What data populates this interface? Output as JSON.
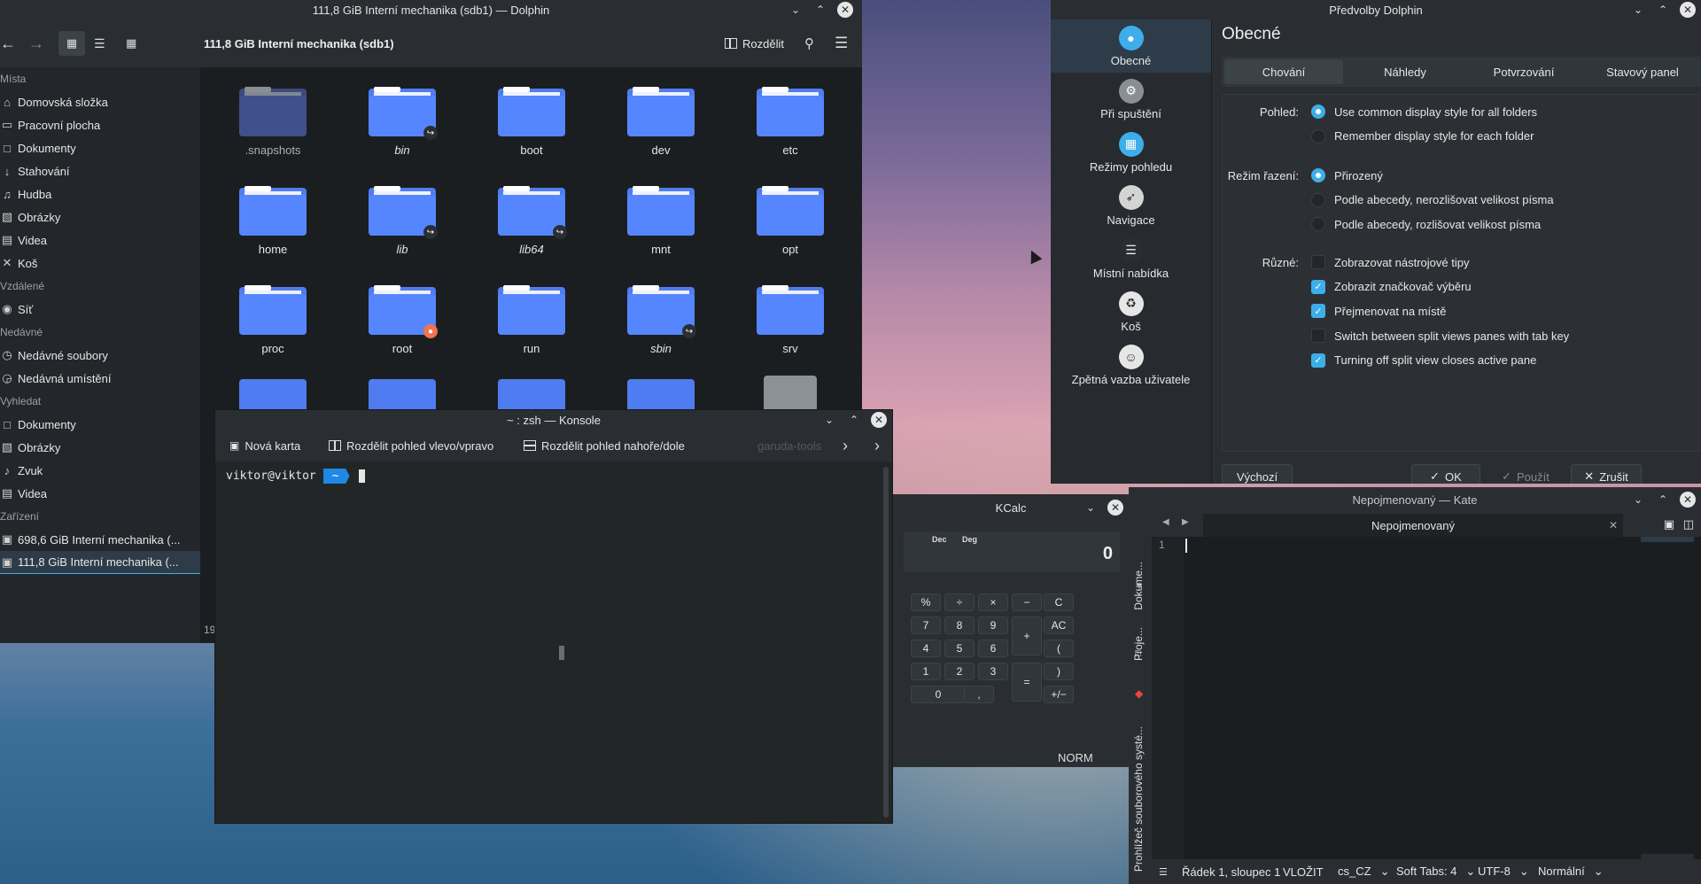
{
  "dolphin": {
    "window_title": "111,8 GiB Interní mechanika (sdb1) — Dolphin",
    "location": "111,8 GiB Interní mechanika (sdb1)",
    "split_label": "Rozdělit",
    "status_partial": "19",
    "sidebar": [
      {
        "type": "section",
        "label": "Místa"
      },
      {
        "type": "item",
        "label": "Domovská složka",
        "icon": "home-icon"
      },
      {
        "type": "item",
        "label": "Pracovní plocha",
        "icon": "desktop-icon"
      },
      {
        "type": "item",
        "label": "Dokumenty",
        "icon": "documents-icon"
      },
      {
        "type": "item",
        "label": "Stahování",
        "icon": "download-icon"
      },
      {
        "type": "item",
        "label": "Hudba",
        "icon": "music-icon"
      },
      {
        "type": "item",
        "label": "Obrázky",
        "icon": "pictures-icon"
      },
      {
        "type": "item",
        "label": "Videa",
        "icon": "videos-icon"
      },
      {
        "type": "item",
        "label": "Koš",
        "icon": "trash-icon"
      },
      {
        "type": "section",
        "label": "Vzdálené"
      },
      {
        "type": "item",
        "label": "Síť",
        "icon": "network-icon"
      },
      {
        "type": "section",
        "label": "Nedávné"
      },
      {
        "type": "item",
        "label": "Nedávné soubory",
        "icon": "recent-files-icon"
      },
      {
        "type": "item",
        "label": "Nedávná umístění",
        "icon": "recent-places-icon"
      },
      {
        "type": "section",
        "label": "Vyhledat"
      },
      {
        "type": "item",
        "label": "Dokumenty",
        "icon": "documents-icon"
      },
      {
        "type": "item",
        "label": "Obrázky",
        "icon": "pictures-icon"
      },
      {
        "type": "item",
        "label": "Zvuk",
        "icon": "audio-icon"
      },
      {
        "type": "item",
        "label": "Videa",
        "icon": "videos-icon"
      },
      {
        "type": "section",
        "label": "Zařízení"
      },
      {
        "type": "item",
        "label": "698,6 GiB Interní mechanika (...",
        "icon": "drive-icon"
      },
      {
        "type": "item",
        "label": "111,8 GiB Interní mechanika (...",
        "icon": "drive-icon",
        "active": true
      }
    ],
    "folders": [
      {
        "name": ".snapshots",
        "hidden": true
      },
      {
        "name": "bin",
        "link": true
      },
      {
        "name": "boot"
      },
      {
        "name": "dev"
      },
      {
        "name": "etc"
      },
      {
        "name": "home"
      },
      {
        "name": "lib",
        "link": true
      },
      {
        "name": "lib64",
        "link": true
      },
      {
        "name": "mnt"
      },
      {
        "name": "opt"
      },
      {
        "name": "proc"
      },
      {
        "name": "root",
        "locked": true
      },
      {
        "name": "run"
      },
      {
        "name": "sbin",
        "link": true
      },
      {
        "name": "srv"
      }
    ]
  },
  "prefs": {
    "window_title": "Předvolby Dolphin",
    "page_title": "Obecné",
    "nav": [
      {
        "label": "Obecné",
        "icon": "general-icon",
        "color": "#3daee9",
        "active": true
      },
      {
        "label": "Při spuštění",
        "icon": "startup-gear-icon",
        "color": "#8a8f94"
      },
      {
        "label": "Režimy pohledu",
        "icon": "view-modes-icon",
        "color": "#3daee9"
      },
      {
        "label": "Navigace",
        "icon": "compass-icon",
        "color": "#d4d4d4"
      },
      {
        "label": "Místní nabídka",
        "icon": "menu-list-icon",
        "color": "#2a2e32"
      },
      {
        "label": "Koš",
        "icon": "trash-icon",
        "color": "#e6e6e6"
      },
      {
        "label": "Zpětná vazba uživatele",
        "icon": "feedback-icon",
        "color": "#e6e6e6"
      }
    ],
    "tabs": [
      "Chování",
      "Náhledy",
      "Potvrzování",
      "Stavový panel"
    ],
    "groups": [
      {
        "label": "Pohled:",
        "options": [
          {
            "kind": "radio",
            "label": "Use common display style for all folders",
            "checked": true
          },
          {
            "kind": "radio",
            "label": "Remember display style for each folder",
            "checked": false
          }
        ]
      },
      {
        "label": "Režim řazení:",
        "options": [
          {
            "kind": "radio",
            "label": "Přirozený",
            "checked": true
          },
          {
            "kind": "radio",
            "label": "Podle abecedy, nerozlišovat velikost písma",
            "checked": false
          },
          {
            "kind": "radio",
            "label": "Podle abecedy, rozlišovat velikost písma",
            "checked": false
          }
        ]
      },
      {
        "label": "Různé:",
        "options": [
          {
            "kind": "check",
            "label": "Zobrazovat nástrojové tipy",
            "checked": false
          },
          {
            "kind": "check",
            "label": "Zobrazit značkovač výběru",
            "checked": true
          },
          {
            "kind": "check",
            "label": "Přejmenovat na místě",
            "checked": true
          },
          {
            "kind": "check",
            "label": "Switch between split views panes with tab key",
            "checked": false
          },
          {
            "kind": "check",
            "label": "Turning off split view closes active pane",
            "checked": true
          }
        ]
      }
    ],
    "buttons": {
      "defaults": "Výchozí",
      "ok": "OK",
      "apply": "Použít",
      "cancel": "Zrušit"
    }
  },
  "konsole": {
    "window_title": "~ : zsh — Konsole",
    "toolbar": {
      "new_tab": "Nová karta",
      "split_lr": "Rozdělit pohled vlevo/vpravo",
      "split_tb": "Rozdělit pohled nahoře/dole",
      "overflow": "garuda-tools"
    },
    "prompt_user": "viktor@viktor",
    "prompt_dir": "~"
  },
  "kcalc": {
    "window_title": "KCalc",
    "mode_dec": "Dec",
    "mode_deg": "Deg",
    "display": "0",
    "buttons": [
      [
        "%",
        "÷",
        "×",
        "−",
        "C"
      ],
      [
        "7",
        "8",
        "9",
        "+",
        "AC"
      ],
      [
        "4",
        "5",
        "6",
        "",
        "("
      ],
      [
        "1",
        "2",
        "3",
        "=",
        ")"
      ],
      [
        "0",
        ",",
        "",
        "",
        "+/−"
      ]
    ],
    "status": "NORM"
  },
  "kate": {
    "window_title": "Nepojmenovaný — Kate",
    "tab_title": "Nepojmenovaný",
    "line_number": "1",
    "side_tabs": [
      "Dokume...",
      "Proje...",
      "Prohlížeč souborového systé..."
    ],
    "status": {
      "position": "Řádek 1, sloupec 1",
      "mode": "VLOŽIT",
      "language": "cs_CZ",
      "indent": "Soft Tabs: 4",
      "encoding": "UTF-8",
      "syntax": "Normální"
    }
  },
  "colors": {
    "accent": "#3daee9",
    "folder": "#4f7cf0",
    "folder_dark": "#3d60d0",
    "window_bg": "#2a2e32"
  }
}
